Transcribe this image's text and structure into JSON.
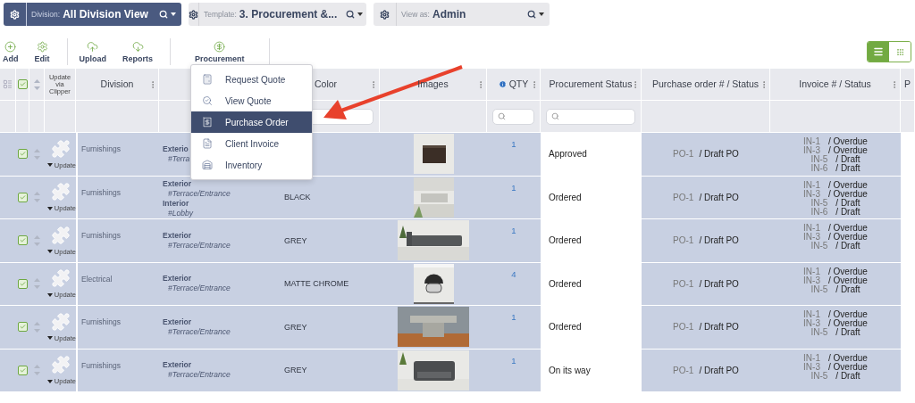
{
  "selectors": [
    {
      "kind": "dark",
      "label": "Division:",
      "value": "All Division View"
    },
    {
      "kind": "light",
      "label": "Template:",
      "value": "3. Procurement &..."
    },
    {
      "kind": "light",
      "label": "View as:",
      "value": "Admin"
    }
  ],
  "toolbar": [
    {
      "label": "Add"
    },
    {
      "label": "Edit"
    },
    {
      "label": "Upload"
    },
    {
      "label": "Reports"
    },
    {
      "label": "Procurement"
    }
  ],
  "view_toggle": [
    {
      "kind": "list",
      "selected": true
    },
    {
      "kind": "grid",
      "selected": false
    }
  ],
  "table": {
    "select_all": {
      "checked": true
    },
    "clipper_header": "Update via Clipper",
    "columns": [
      {
        "label": "Division",
        "menu": true,
        "filter": false
      },
      {
        "menu": false,
        "filter": false
      },
      {
        "label": "Color",
        "menu": true,
        "filter": true
      },
      {
        "label": "Images",
        "menu": true,
        "filter": false
      },
      {
        "label": "QTY",
        "info": true,
        "menu": true,
        "filter": true
      },
      {
        "label": "Procurement Status",
        "menu": true,
        "filter": true
      },
      {
        "label": "Purchase order # / Status",
        "menu": true,
        "filter": false
      },
      {
        "label": "Invoice # / Status",
        "menu": true,
        "filter": false
      },
      {
        "label": "P",
        "menu": false,
        "filter": false
      }
    ],
    "rows": [
      {
        "checked": true,
        "update": "Update",
        "division": "Furnishings",
        "location": [
          {
            "area": "Exterio",
            "tag": "#Terra"
          }
        ],
        "image": {
          "kind": "picture"
        },
        "qty": "1",
        "status": "Approved",
        "po": "PO-1",
        "po_status": "/ Draft PO",
        "invoices": [
          {
            "number": "IN-1",
            "status": "/ Overdue"
          },
          {
            "number": "IN-3",
            "status": "/ Overdue"
          },
          {
            "number": "IN-5",
            "status": "/ Draft"
          },
          {
            "number": "IN-6",
            "status": "/ Draft"
          }
        ]
      },
      {
        "checked": true,
        "update": "Update",
        "division": "Furnishings",
        "location": [
          {
            "area": "Exterior",
            "tag": "#Terrace/Entrance"
          },
          {
            "area": "Interior",
            "tag": "#Lobby"
          }
        ],
        "finish": "BLACK",
        "image": {
          "kind": "picture"
        },
        "qty": "1",
        "status": "Ordered",
        "po": "PO-1",
        "po_status": "/ Draft PO",
        "invoices": [
          {
            "number": "IN-1",
            "status": "/ Overdue"
          },
          {
            "number": "IN-3",
            "status": "/ Overdue"
          },
          {
            "number": "IN-5",
            "status": "/ Draft"
          },
          {
            "number": "IN-6",
            "status": "/ Draft"
          }
        ]
      },
      {
        "checked": true,
        "update": "Update",
        "division": "Furnishings",
        "location": [
          {
            "area": "Exterior",
            "tag": "#Terrace/Entrance"
          }
        ],
        "finish": "GREY",
        "image": {
          "kind": "picture"
        },
        "qty": "1",
        "status": "Ordered",
        "po": "PO-1",
        "po_status": "/ Draft PO",
        "invoices": [
          {
            "number": "IN-1",
            "status": "/ Overdue"
          },
          {
            "number": "IN-3",
            "status": "/ Overdue"
          },
          {
            "number": "IN-5",
            "status": "/ Draft"
          }
        ]
      },
      {
        "checked": true,
        "update": "Update",
        "division": "Electrical",
        "location": [
          {
            "area": "Exterior",
            "tag": "#Terrace/Entrance"
          }
        ],
        "finish": "MATTE CHROME",
        "image": {
          "kind": "picture"
        },
        "qty": "4",
        "status": "Ordered",
        "po": "PO-1",
        "po_status": "/ Draft PO",
        "invoices": [
          {
            "number": "IN-1",
            "status": "/ Overdue"
          },
          {
            "number": "IN-3",
            "status": "/ Overdue"
          },
          {
            "number": "IN-5",
            "status": "/ Draft"
          }
        ]
      },
      {
        "checked": true,
        "update": "Update",
        "division": "Furnishings",
        "location": [
          {
            "area": "Exterior",
            "tag": "#Terrace/Entrance"
          }
        ],
        "finish": "GREY",
        "image": {
          "kind": "picture"
        },
        "qty": "1",
        "status": "Ordered",
        "po": "PO-1",
        "po_status": "/ Draft PO",
        "invoices": [
          {
            "number": "IN-1",
            "status": "/ Overdue"
          },
          {
            "number": "IN-3",
            "status": "/ Overdue"
          },
          {
            "number": "IN-5",
            "status": "/ Draft"
          }
        ]
      },
      {
        "checked": true,
        "update": "Update",
        "division": "Furnishings",
        "location": [
          {
            "area": "Exterior",
            "tag": "#Terrace/Entrance"
          }
        ],
        "finish": "GREY",
        "image": {
          "kind": "picture"
        },
        "qty": "1",
        "status": "On its way",
        "po": "PO-1",
        "po_status": "/ Draft PO",
        "invoices": [
          {
            "number": "IN-1",
            "status": "/ Overdue"
          },
          {
            "number": "IN-3",
            "status": "/ Overdue"
          },
          {
            "number": "IN-5",
            "status": "/ Draft"
          }
        ]
      }
    ]
  },
  "menu": {
    "items": [
      {
        "label": "Request Quote",
        "selected": false
      },
      {
        "label": "View Quote",
        "selected": false
      },
      {
        "label": "Purchase Order",
        "selected": true
      },
      {
        "label": "Client Invoice",
        "selected": false
      },
      {
        "label": "Inventory",
        "selected": false
      }
    ]
  }
}
